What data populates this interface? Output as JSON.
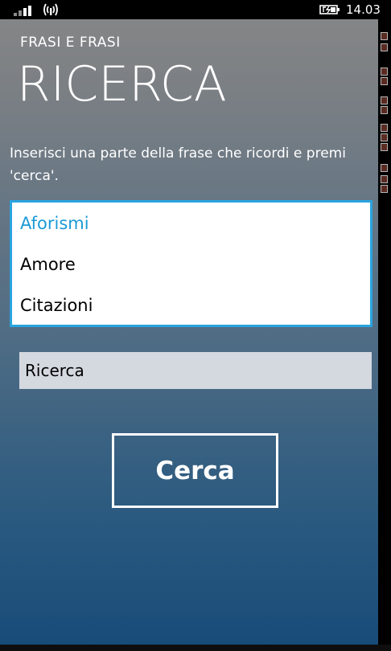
{
  "status_bar": {
    "time": "14.03",
    "signal_icon": "signal-strength-icon",
    "wireless_icon": "wireless-icon",
    "battery_icon": "battery-charging-icon"
  },
  "header": {
    "app_title": "FRASI E FRASI",
    "page_title": "RICERCA"
  },
  "instructions": "Inserisci una parte della frase che ricordi e premi 'cerca'.",
  "categories": {
    "items": [
      {
        "label": "Aforismi",
        "selected": true
      },
      {
        "label": "Amore",
        "selected": false
      },
      {
        "label": "Citazioni",
        "selected": false
      }
    ]
  },
  "search": {
    "value": "Ricerca"
  },
  "button": {
    "label": "Cerca"
  },
  "colors": {
    "accent": "#1b9ad6",
    "background_top": "#878787",
    "background_bottom": "#174b78"
  }
}
